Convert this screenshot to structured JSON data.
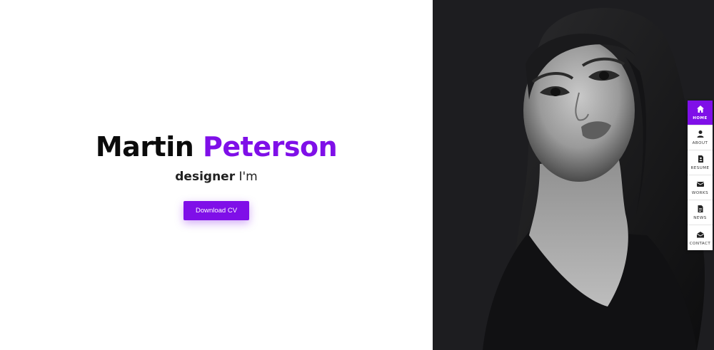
{
  "hero": {
    "first_name": "Martin",
    "last_name": "Peterson",
    "role_strong": "designer",
    "role_rest": "I'm",
    "cta_label": "Download CV"
  },
  "portrait": {
    "icon": "portrait-photo"
  },
  "nav": {
    "items": [
      {
        "label": "HOME",
        "icon": "home-icon",
        "active": true
      },
      {
        "label": "ABOUT",
        "icon": "user-icon",
        "active": false
      },
      {
        "label": "RESUME",
        "icon": "resume-icon",
        "active": false
      },
      {
        "label": "WORKS",
        "icon": "works-icon",
        "active": false
      },
      {
        "label": "NEWS",
        "icon": "news-icon",
        "active": false
      },
      {
        "label": "CONTACT",
        "icon": "envelope-icon",
        "active": false
      }
    ]
  },
  "colors": {
    "accent": "#7f0fe8",
    "dark_panel": "#1d1d20"
  }
}
